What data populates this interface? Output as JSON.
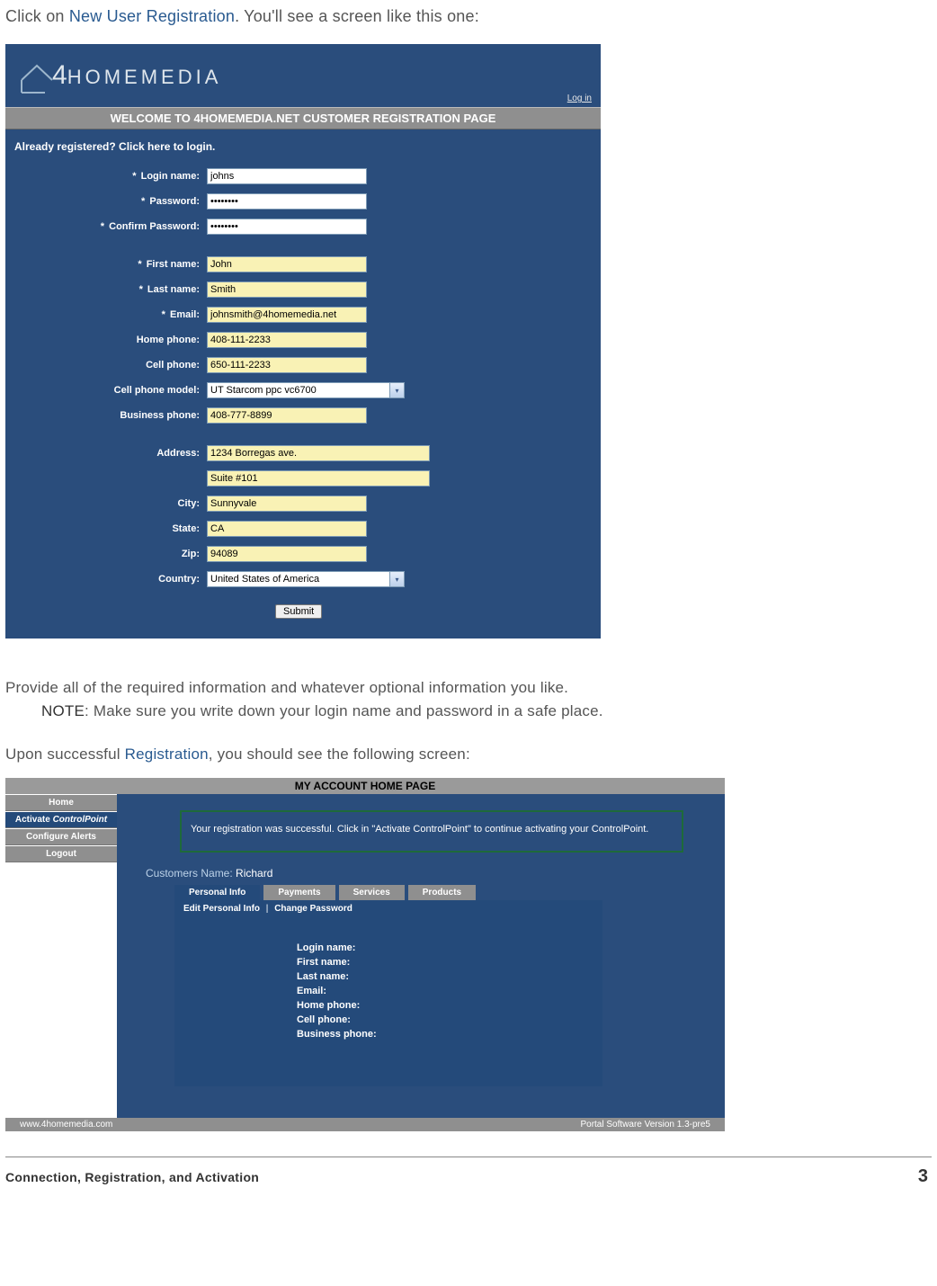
{
  "intro": {
    "prefix": "Click on ",
    "link": "New User Registration",
    "suffix": ". You'll see a screen like this one:"
  },
  "shot1": {
    "logo_text_1": "4",
    "logo_text_2": "HOMEMEDIA",
    "login_link": "Log in",
    "welcome": "WELCOME  TO  4HOMEMEDIA.NET  CUSTOMER  REGISTRATION  PAGE",
    "already": "Already registered? Click here to login.",
    "fields": {
      "login_label": "Login name:",
      "login_value": "johns",
      "password_label": "Password:",
      "password_value": "••••••••",
      "confirm_label": "Confirm Password:",
      "confirm_value": "••••••••",
      "first_label": "First name:",
      "first_value": "John",
      "last_label": "Last name:",
      "last_value": "Smith",
      "email_label": "Email:",
      "email_value": "johnsmith@4homemedia.net",
      "home_label": "Home phone:",
      "home_value": "408-111-2233",
      "cell_label": "Cell phone:",
      "cell_value": "650-111-2233",
      "model_label": "Cell phone model:",
      "model_value": "UT Starcom ppc vc6700",
      "bus_label": "Business phone:",
      "bus_value": "408-777-8899",
      "addr_label": "Address:",
      "addr1_value": "1234 Borregas ave.",
      "addr2_value": "Suite #101",
      "city_label": "City:",
      "city_value": "Sunnyvale",
      "state_label": "State:",
      "state_value": "CA",
      "zip_label": "Zip:",
      "zip_value": "94089",
      "country_label": "Country:",
      "country_value": "United States of America"
    },
    "submit": "Submit",
    "ast": "*"
  },
  "mid": {
    "p1": "Provide all of the required information and whatever optional information you like.",
    "note_label": "NOTE",
    "note_text": ": Make sure you write down your login name and password in a safe place.",
    "p2_prefix": "Upon successful ",
    "p2_link": "Registration",
    "p2_suffix": ", you should see the following screen:"
  },
  "shot2": {
    "title": "MY ACCOUNT HOME PAGE",
    "nav": {
      "home": "Home",
      "activate_pre": "Activate ",
      "activate_ital": "ControlPoint",
      "alerts": "Configure Alerts",
      "logout": "Logout"
    },
    "success": "Your registration was successful. Click in \"Activate ControlPoint\" to continue activating your ControlPoint.",
    "cust_label": "Customers Name: ",
    "cust_value": "Richard",
    "tabs": {
      "personal": "Personal Info",
      "payments": "Payments",
      "services": "Services",
      "products": "Products"
    },
    "subtabs": {
      "edit": "Edit Personal Info",
      "sep": "|",
      "change": "Change Password"
    },
    "info": {
      "login": "Login name:",
      "first": "First name:",
      "last": "Last name:",
      "email": "Email:",
      "home": "Home phone:",
      "cell": "Cell phone:",
      "bus": "Business phone:"
    },
    "footer_left": "www.4homemedia.com",
    "footer_right": "Portal Software Version 1.3-pre5"
  },
  "footer": {
    "left": "Connection, Registration, and Activation",
    "right": "3"
  }
}
